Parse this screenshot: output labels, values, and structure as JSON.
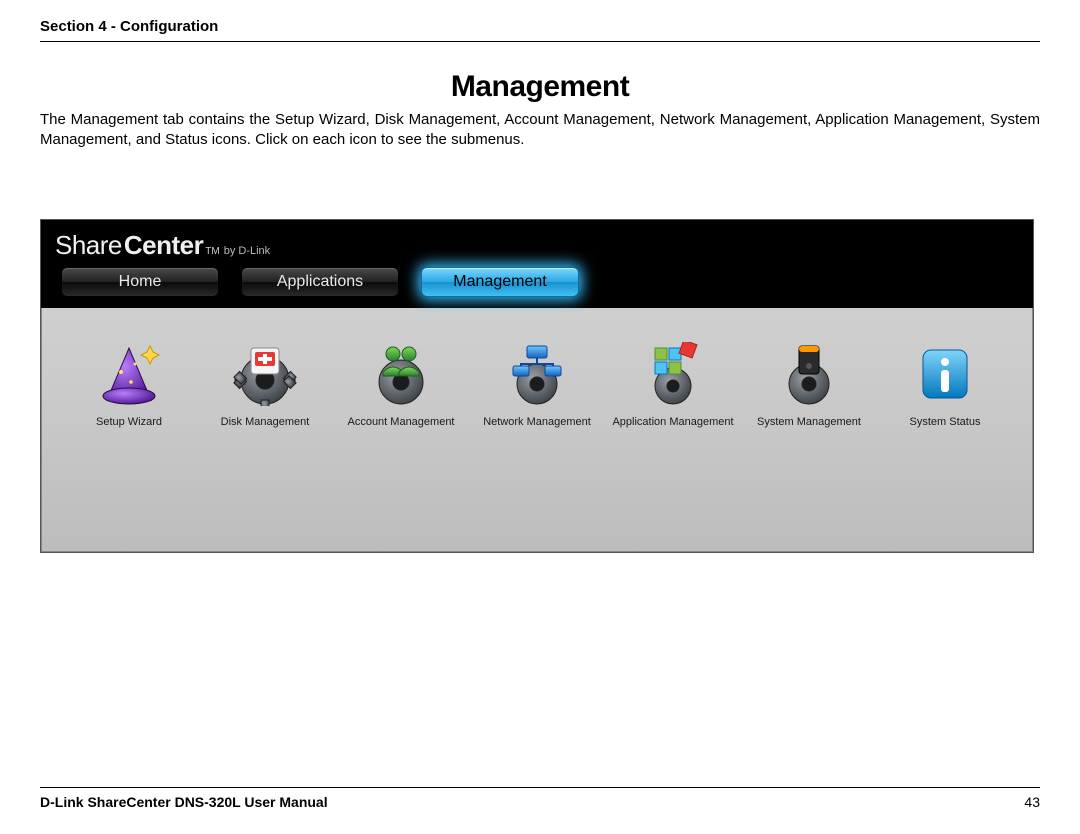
{
  "header": {
    "section": "Section 4 - Configuration"
  },
  "title": "Management",
  "body": "The Management tab contains the Setup Wizard, Disk Management, Account Management, Network Management, Application Management, System Management, and Status icons. Click on each icon to see the submenus.",
  "brand": {
    "left": "Share",
    "right": "Center",
    "tm": "TM",
    "sub": "by D-Link"
  },
  "tabs": [
    {
      "label": "Home",
      "active": false
    },
    {
      "label": "Applications",
      "active": false
    },
    {
      "label": "Management",
      "active": true
    }
  ],
  "icons": [
    {
      "label": "Setup Wizard",
      "name": "wizard-icon"
    },
    {
      "label": "Disk Management",
      "name": "disk-management-icon"
    },
    {
      "label": "Account Management",
      "name": "account-management-icon"
    },
    {
      "label": "Network Management",
      "name": "network-management-icon"
    },
    {
      "label": "Application Management",
      "name": "application-management-icon"
    },
    {
      "label": "System Management",
      "name": "system-management-icon"
    },
    {
      "label": "System Status",
      "name": "system-status-icon"
    }
  ],
  "footer": {
    "left": "D-Link ShareCenter DNS-320L User Manual",
    "right": "43"
  }
}
